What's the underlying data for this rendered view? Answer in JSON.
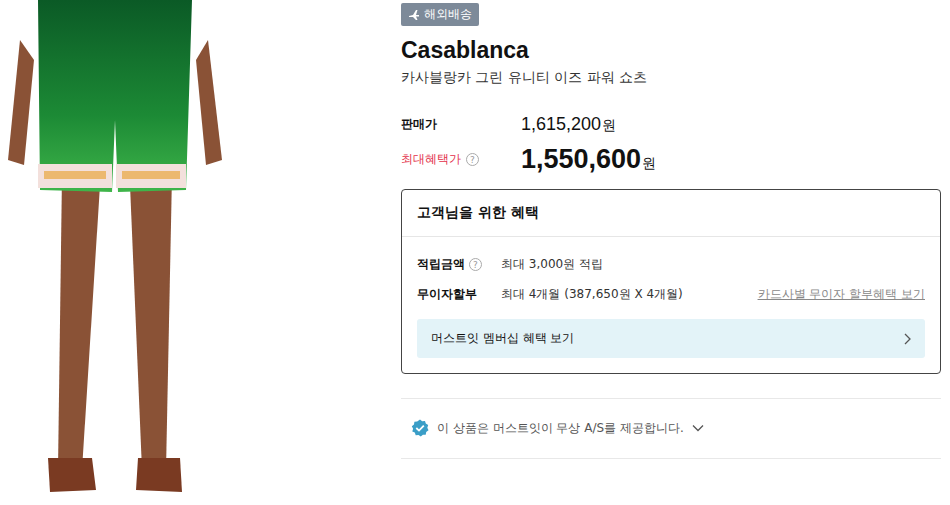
{
  "badge": {
    "label": "해외배송"
  },
  "brand": "Casablanca",
  "product_name": "카사블랑카 그린 유니티 이즈 파워 쇼츠",
  "prices": [
    {
      "kind": "regular",
      "label": "판매가",
      "help": "",
      "amount": "1,615,200",
      "unit": "원"
    },
    {
      "kind": "best",
      "label": "최대혜택가",
      "help": "?",
      "amount": "1,550,600",
      "unit": "원"
    }
  ],
  "benefits": {
    "title": "고객님을 위한 혜택",
    "rows": [
      {
        "label": "적립금액",
        "help": "?",
        "value": "최대 3,000원 적립",
        "link": ""
      },
      {
        "label": "무이자할부",
        "help": "",
        "value": "최대 4개월 (387,650원 X 4개월)",
        "link": "카드사별 무이자 할부혜택 보기"
      }
    ],
    "membership_button": "머스트잇 멤버십 혜택 보기"
  },
  "as_notice": {
    "text": "이 상품은 머스트잇이 무상 A/S를 제공합니다.",
    "expanded": false
  }
}
